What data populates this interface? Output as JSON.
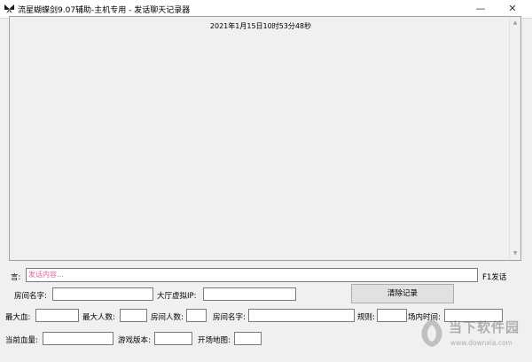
{
  "window": {
    "title": "流星蝴蝶剑9.07辅助-主机专用 - 发话聊天记录器",
    "minimize_glyph": "—",
    "close_glyph": "✕"
  },
  "log": {
    "timestamp": "2021年1月15日10时53分48秒"
  },
  "chat": {
    "label": "言:",
    "placeholder": "发话内容...",
    "f1_label": "F1发话"
  },
  "row1": {
    "room_name_label": "房间名字:",
    "room_name_value": "",
    "lobby_ip_label": "大厅虚拟IP:",
    "lobby_ip_value": "",
    "clear_button": "清除记录"
  },
  "row2": {
    "max_hp_label": "最大血:",
    "max_players_label": "最大人数:",
    "room_players_label": "房间人数:",
    "room_name_label": "房间名字:",
    "rules_label": "规则:",
    "match_time_label": "场内时间:"
  },
  "row3": {
    "current_hp_label": "当前血量:",
    "game_version_label": "游戏版本:",
    "start_map_label": "开场地图:"
  },
  "watermark": {
    "name": "当下软件园",
    "url": "www.downxia.com"
  },
  "colors": {
    "placeholder": "#e060a0",
    "window_bg": "#f0f0f0"
  }
}
